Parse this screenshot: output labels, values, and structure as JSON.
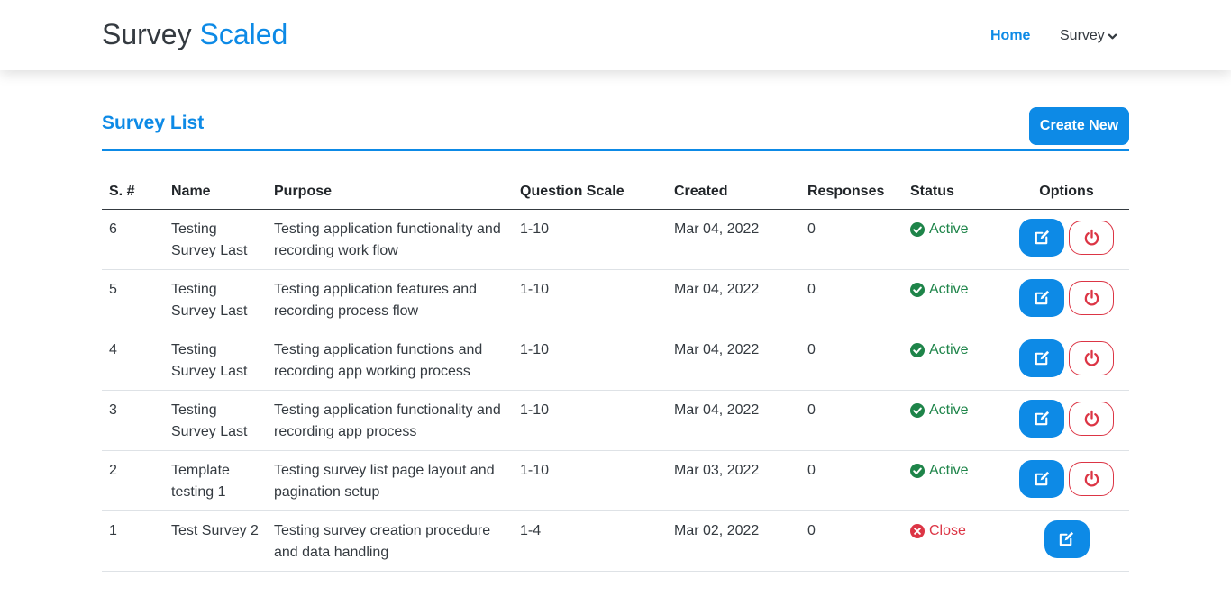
{
  "nav": {
    "brand_part1": "Survey",
    "brand_part2": "Scaled",
    "home_label": "Home",
    "survey_label": "Survey"
  },
  "page": {
    "title": "Survey List",
    "create_label": "Create New"
  },
  "table": {
    "headers": [
      "S. #",
      "Name",
      "Purpose",
      "Question Scale",
      "Created",
      "Responses",
      "Status",
      "Options"
    ],
    "rows": [
      {
        "sn": "6",
        "name": "Testing Survey Last",
        "purpose": "Testing application functionality and recording work flow",
        "scale": "1-10",
        "created": "Mar 04, 2022",
        "responses": "0",
        "status": "Active"
      },
      {
        "sn": "5",
        "name": "Testing Survey Last",
        "purpose": "Testing application features and recording process flow",
        "scale": "1-10",
        "created": "Mar 04, 2022",
        "responses": "0",
        "status": "Active"
      },
      {
        "sn": "4",
        "name": "Testing Survey Last",
        "purpose": "Testing application functions and recording app working process",
        "scale": "1-10",
        "created": "Mar 04, 2022",
        "responses": "0",
        "status": "Active"
      },
      {
        "sn": "3",
        "name": "Testing Survey Last",
        "purpose": "Testing application functionality and recording app process",
        "scale": "1-10",
        "created": "Mar 04, 2022",
        "responses": "0",
        "status": "Active"
      },
      {
        "sn": "2",
        "name": "Template testing 1",
        "purpose": "Testing survey list page layout and pagination setup",
        "scale": "1-10",
        "created": "Mar 03, 2022",
        "responses": "0",
        "status": "Active"
      },
      {
        "sn": "1",
        "name": "Test Survey 2",
        "purpose": "Testing survey creation procedure and data handling",
        "scale": "1-4",
        "created": "Mar 02, 2022",
        "responses": "0",
        "status": "Close"
      }
    ]
  },
  "colors": {
    "primary": "#0d8ae6",
    "active": "#1e8449",
    "danger": "#dc3545"
  },
  "icons": {
    "dropdown": "chevron-down-icon",
    "active": "check-circle-icon",
    "close": "x-circle-icon",
    "edit": "edit-icon",
    "power": "power-icon"
  }
}
